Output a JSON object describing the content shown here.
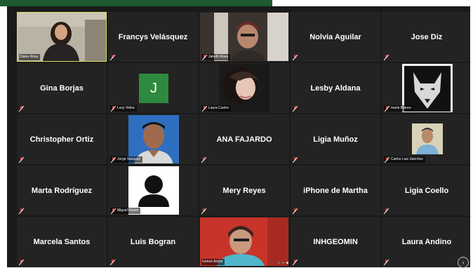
{
  "gallery": {
    "row1": {
      "diana": "Diana Rosa",
      "francys": "Francys Velásquez",
      "janeth": "Janeth Rosa",
      "nolvia": "Nolvia Aguilar",
      "jose": "Jose Diz"
    },
    "row2": {
      "gina": "Gina Borjas",
      "lucy_initial": "J",
      "lucy": "Lucy Videa",
      "laura": "Laura Castro",
      "lesby": "Lesby Aldana",
      "mario": "mario Blanco"
    },
    "row3": {
      "christopher": "Christopher Ortiz",
      "jorge": "Jorge Vasquez",
      "ana": "ANA FAJARDO",
      "ligia_m": "Ligia Muñoz",
      "carlos": "Carlos Luis Sanchez"
    },
    "row4": {
      "marta": "Marta Rodríguez",
      "miguel": "Miguel Reyes",
      "mery": "Mery Reyes",
      "iphone": "iPhone de Martha",
      "ligia_c": "Ligia Coello"
    },
    "row5": {
      "marcela": "Marcela Santos",
      "luis": "Luis Bogran",
      "ivonne": "Ivonne Ardón",
      "inhgeomin": "INHGEOMIN",
      "laura_a": "Laura Andino"
    }
  },
  "colors": {
    "accent_bar": "#1e5a32",
    "active_speaker": "#d8e063",
    "initial_tile": "#2e8a3e",
    "muted_red": "#e23b3b"
  },
  "icons": {
    "muted": "microphone-muted-icon",
    "next_page": "chevron-right-icon",
    "avatar": "person-silhouette-icon"
  }
}
